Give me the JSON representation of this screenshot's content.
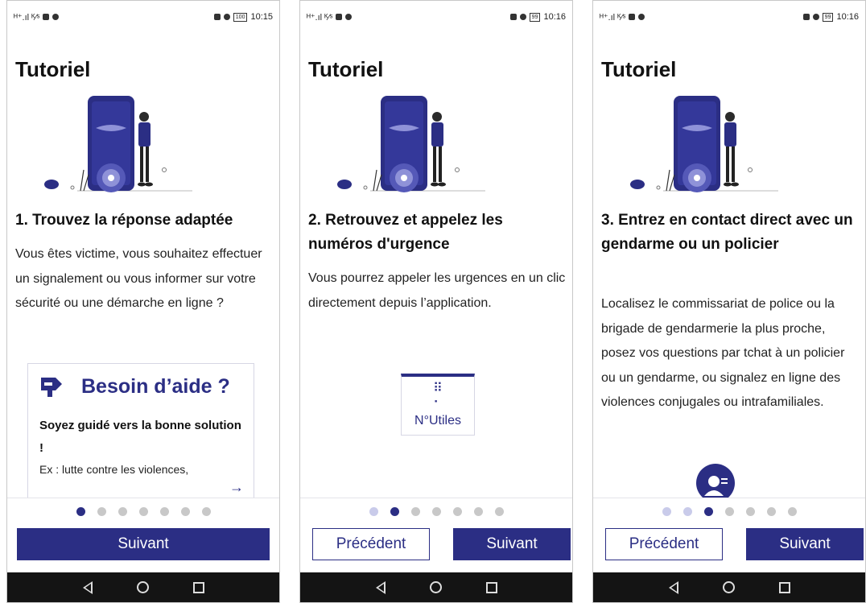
{
  "colors": {
    "brand": "#2b2e84",
    "dot_inactive": "#c8c8c8",
    "dot_done": "#c9cbea"
  },
  "screens": [
    {
      "status": {
        "left": "ᴴ⁺.ıl ᴷ⁄ˢ",
        "time": "10:15",
        "battery": "100"
      },
      "title": "Tutoriel",
      "step_title": "1. Trouvez la réponse adaptée",
      "description": "Vous êtes victime, vous souhaitez effectuer un signalement ou vous informer sur votre sécurité ou une démarche en ligne ?",
      "card": {
        "icon": "signpost-icon",
        "title": "Besoin d’aide ?",
        "subtitle": "Soyez guidé vers la bonne solution !",
        "example": "Ex : lutte contre les violences,"
      },
      "buttons": {
        "next": "Suivant"
      }
    },
    {
      "status": {
        "left": "ᴴ⁺.ıl ᴷ⁄ˢ",
        "time": "10:16",
        "battery": "99"
      },
      "title": "Tutoriel",
      "step_title": "2. Retrouvez et appelez les numéros d'urgence",
      "description": "Vous pourrez appeler les urgences en un clic directement depuis l’application.",
      "card": {
        "icon": "keypad-icon",
        "label": "N°Utiles"
      },
      "buttons": {
        "prev": "Précédent",
        "next": "Suivant"
      }
    },
    {
      "status": {
        "left": "ᴴ⁺.ıl ᴷ⁄ˢ",
        "time": "10:16",
        "battery": "99"
      },
      "title": "Tutoriel",
      "step_title": "3. Entrez en contact direct avec un gendarme ou un policier",
      "description": "Localisez le commissariat de police ou la brigade de gendarmerie la plus proche, posez vos questions par tchat à un policier ou un gendarme, ou signalez en ligne des violences conjugales ou intrafamiliales.",
      "card": {
        "icon": "contact-person-icon"
      },
      "buttons": {
        "prev": "Précédent",
        "next": "Suivant"
      }
    }
  ],
  "pager": {
    "total": 7,
    "active": [
      0,
      1,
      2
    ]
  }
}
